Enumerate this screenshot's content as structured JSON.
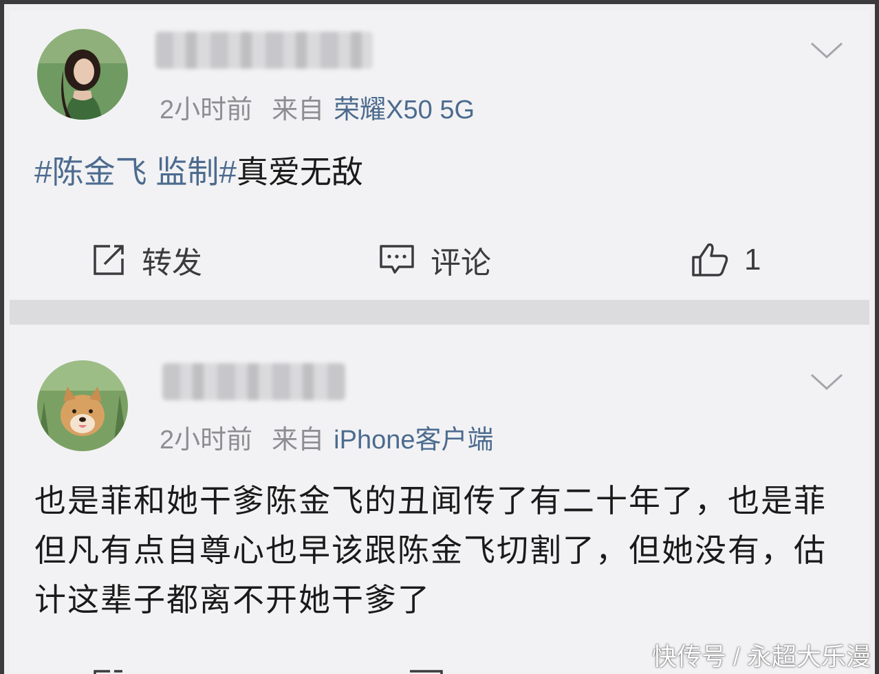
{
  "posts": [
    {
      "time": "2小时前",
      "source_prefix": "来自",
      "device": "荣耀X50 5G",
      "hashtag": "#陈金飞 监制#",
      "text": "真爱无敌",
      "actions": {
        "repost": "转发",
        "comment": "评论",
        "like_count": "1"
      }
    },
    {
      "time": "2小时前",
      "source_prefix": "来自",
      "device": "iPhone客户端",
      "text": "也是菲和她干爹陈金飞的丑闻传了有二十年了，也是菲但凡有点自尊心也早该跟陈金飞切割了，但她没有，估计这辈子都离不开她干爹了"
    }
  ],
  "watermark": "快传号 / 永超大乐漫",
  "colors": {
    "link": "#4c6b8e",
    "meta": "#8d8d92",
    "text": "#1a1a1a",
    "background": "#f2f2f4"
  },
  "icons": [
    "chevron-down-icon",
    "repost-icon",
    "comment-icon",
    "like-icon"
  ]
}
